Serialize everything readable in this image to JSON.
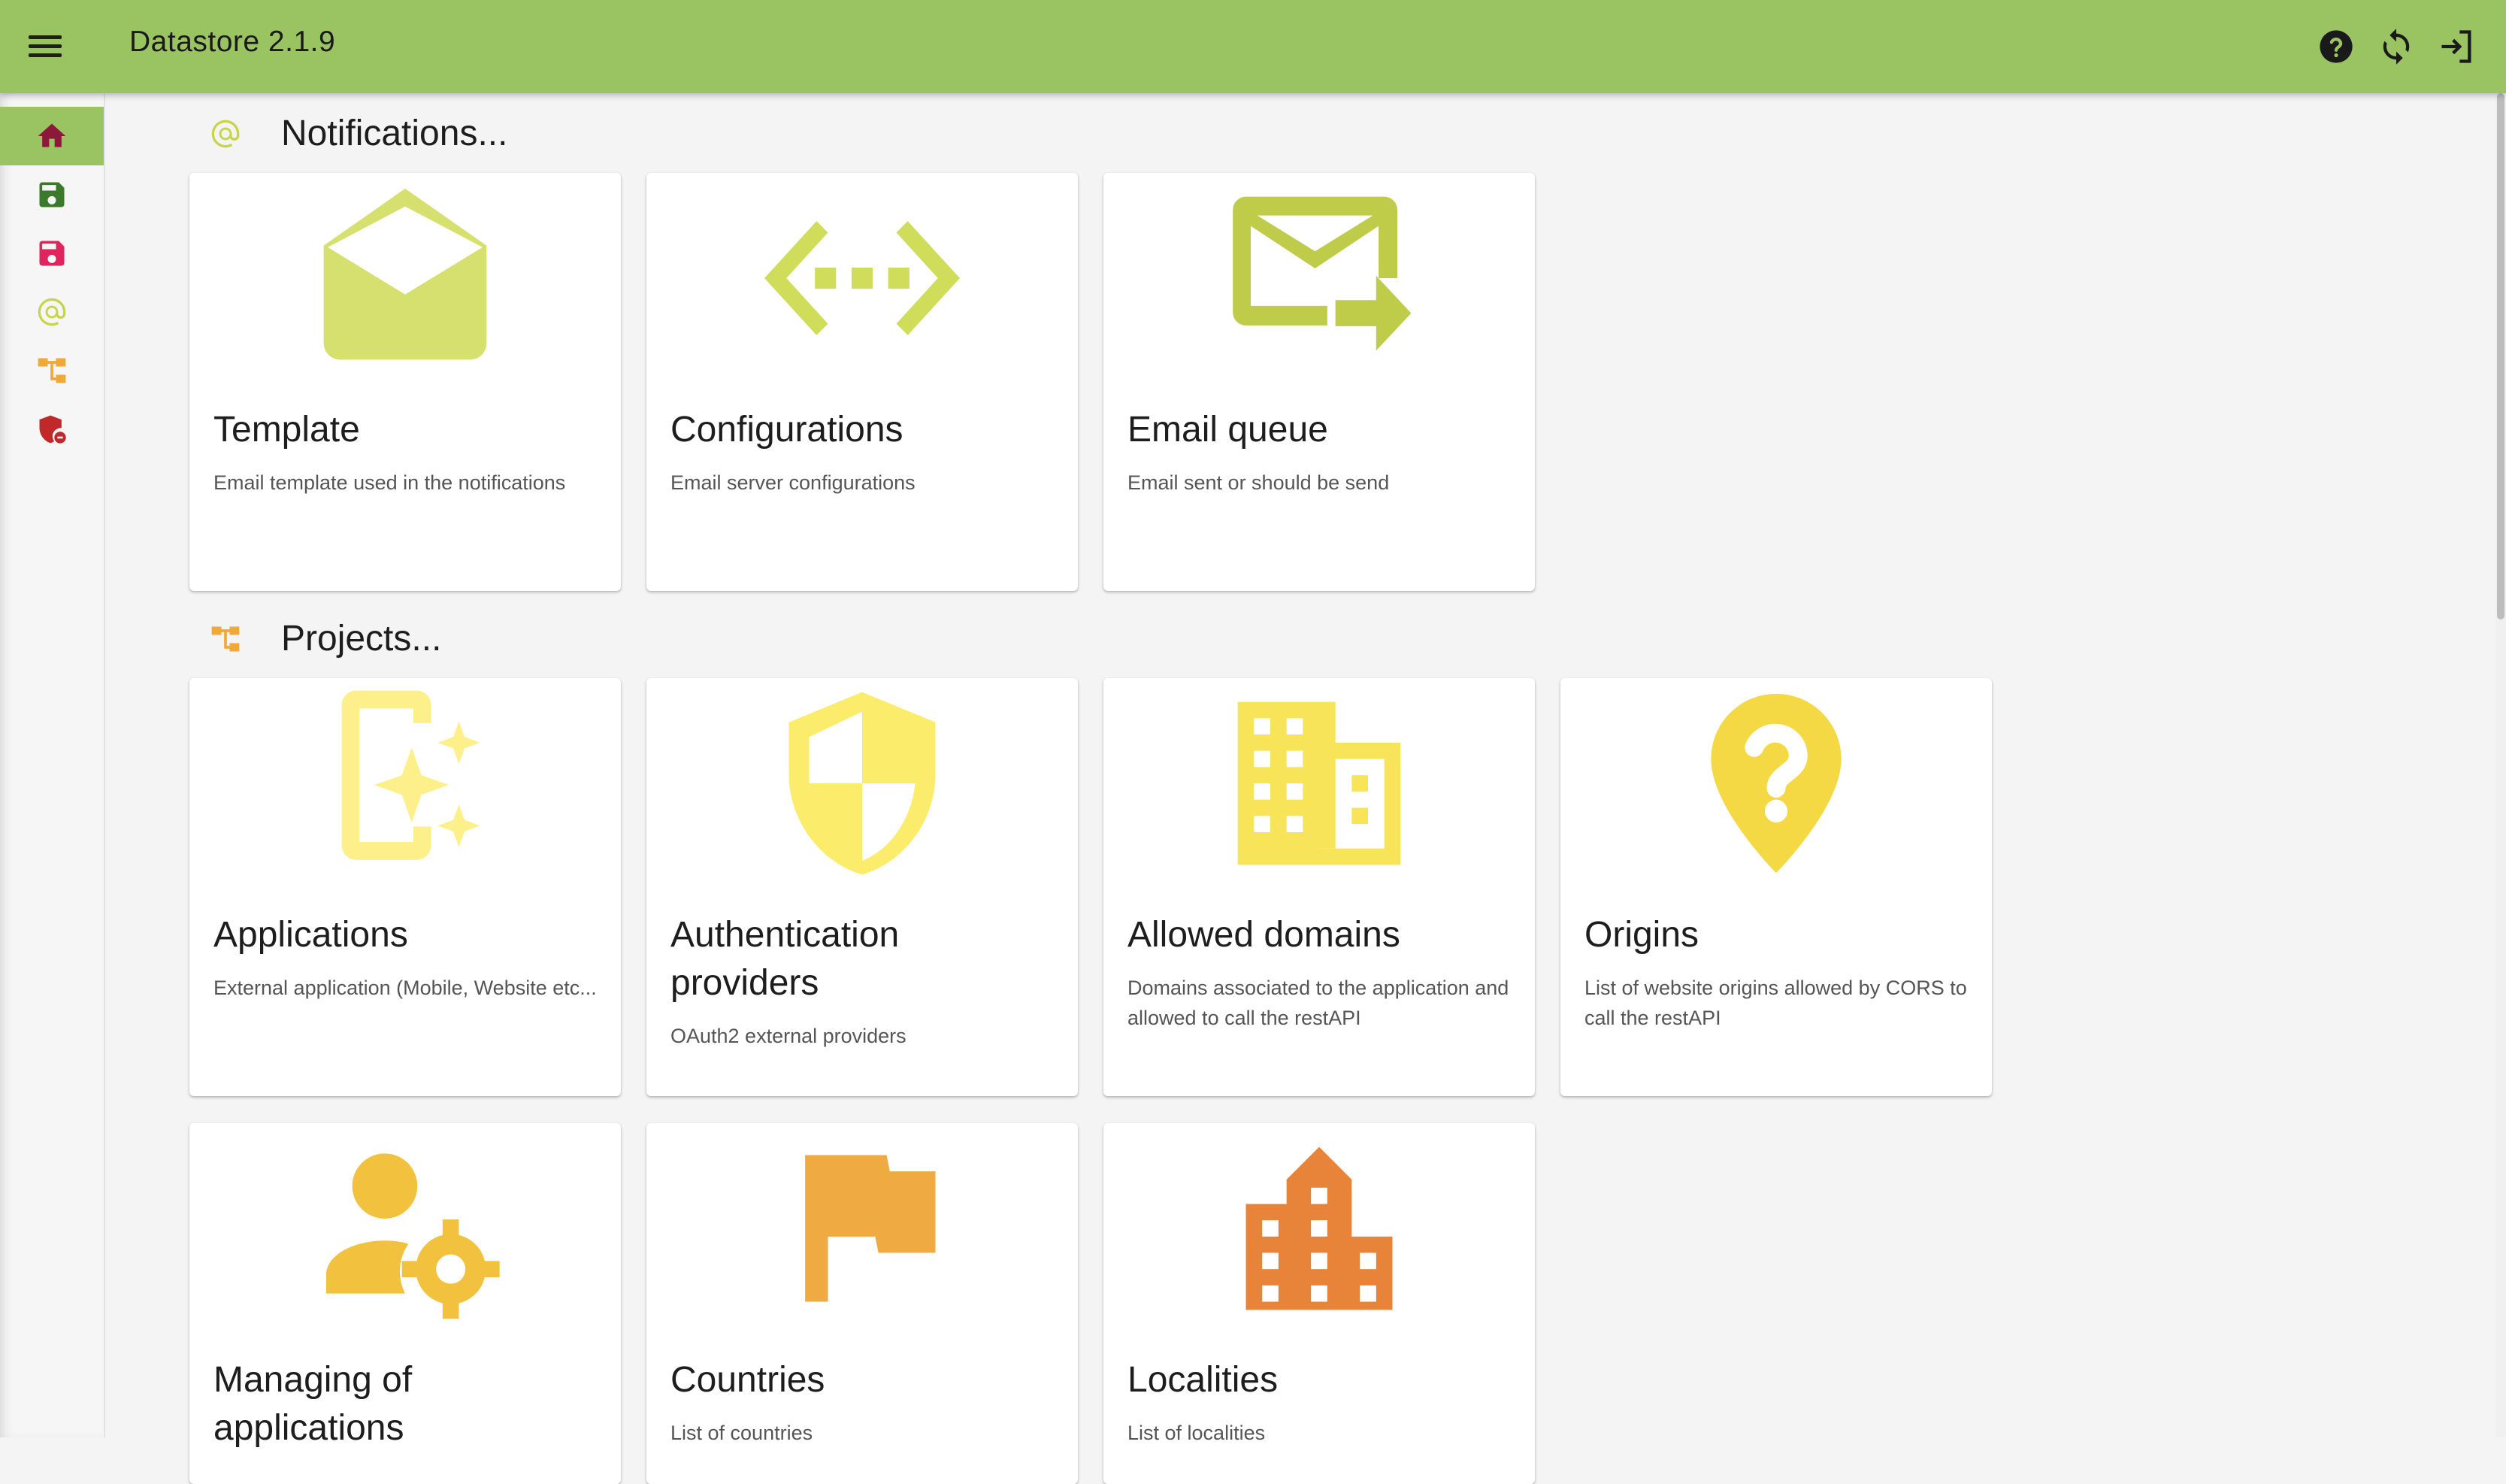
{
  "app": {
    "title": "Datastore 2.1.9"
  },
  "toolbar": {
    "menu": "menu-icon",
    "help": "help-icon",
    "refresh": "sync-icon",
    "logout": "logout-icon"
  },
  "sidebar": {
    "items": [
      {
        "icon": "home-icon",
        "active": true,
        "color": "#8b1a3a"
      },
      {
        "icon": "save-icon",
        "color": "#3a7a2a"
      },
      {
        "icon": "save-icon",
        "color": "#e0245e"
      },
      {
        "icon": "at-icon",
        "color": "#c8d44a"
      },
      {
        "icon": "project-tree-icon",
        "color": "#f0a838"
      },
      {
        "icon": "security-shield-icon",
        "color": "#c0282a"
      }
    ]
  },
  "sections": [
    {
      "title": "Notifications...",
      "icon": "at-icon",
      "cards": [
        {
          "title": "Template",
          "desc": "Email template used in the notifications",
          "icon": "drafts-icon",
          "color": "#d6e06e"
        },
        {
          "title": "Configurations",
          "desc": "Email server configurations",
          "icon": "settings-ethernet-icon",
          "color": "#cfdd5a"
        },
        {
          "title": "Email queue",
          "desc": "Email sent or should be send",
          "icon": "forward-mail-icon",
          "color": "#bfcc4a"
        }
      ]
    },
    {
      "title": "Projects...",
      "icon": "project-tree-icon",
      "cards": [
        {
          "title": "Applications",
          "desc": "External application (Mobile, Website etc...",
          "icon": "app-sparkle-icon",
          "color": "#fdf08a"
        },
        {
          "title": "Authentication providers",
          "desc": "OAuth2 external providers",
          "icon": "shield-icon",
          "color": "#fcec6c"
        },
        {
          "title": "Allowed domains",
          "desc": "Domains associated to the application and allowed to call the restAPI",
          "icon": "domain-icon",
          "color": "#f8e458"
        },
        {
          "title": "Origins",
          "desc": "List of website origins allowed by CORS to call the restAPI",
          "icon": "location-question-icon",
          "color": "#f4d944"
        },
        {
          "title": "Managing of applications",
          "desc": "",
          "icon": "manage-accounts-icon",
          "color": "#f2c23f"
        },
        {
          "title": "Countries",
          "desc": "List of countries",
          "icon": "flag-icon",
          "color": "#efaa42"
        },
        {
          "title": "Localities",
          "desc": "List of localities",
          "icon": "location-city-icon",
          "color": "#e8843a"
        }
      ]
    }
  ]
}
